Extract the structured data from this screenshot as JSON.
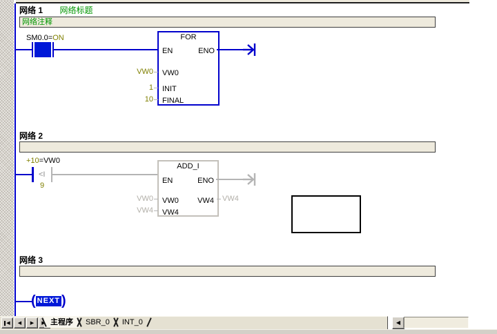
{
  "networks": [
    {
      "label": "网络 1",
      "title": "网络标题",
      "comment": "网络注释"
    },
    {
      "label": "网络 2",
      "title": "",
      "comment": ""
    },
    {
      "label": "网络 3",
      "title": "",
      "comment": ""
    }
  ],
  "rung1": {
    "contact_address": "SM0.0=",
    "contact_state": "ON",
    "box_title": "FOR",
    "en_label": "EN",
    "eno_label": "ENO",
    "inputs": [
      {
        "operand": "VW0",
        "param": "VW0"
      },
      {
        "operand": "1",
        "param": "INIT"
      },
      {
        "operand": "10",
        "param": "FINAL"
      }
    ]
  },
  "rung2": {
    "compare_state": "+10",
    "compare_address": "=VW0",
    "compare_operator": "<I",
    "compare_operand": "9",
    "box_title": "ADD_I",
    "en_label": "EN",
    "eno_label": "ENO",
    "inputs": [
      {
        "status": "VW0",
        "param": "VW0"
      },
      {
        "status": "VW4",
        "param": "VW4"
      }
    ],
    "output": {
      "param": "VW4",
      "status": "VW4"
    }
  },
  "rung3": {
    "coil_label": "NEXT"
  },
  "tabs": [
    {
      "label": "主程序"
    },
    {
      "label": "SBR_0"
    },
    {
      "label": "INT_0"
    }
  ],
  "nav": [
    {
      "glyph": "◀"
    },
    {
      "glyph": "◀"
    },
    {
      "glyph": "▶"
    },
    {
      "glyph": "▶"
    }
  ],
  "scrollbar": {
    "left_arrow": "◀"
  },
  "colors": {
    "power_blue": "#0000cc",
    "no_power_gray": "#b4b4b4",
    "operand_olive": "#7f7f00",
    "comment_green": "#009600"
  }
}
